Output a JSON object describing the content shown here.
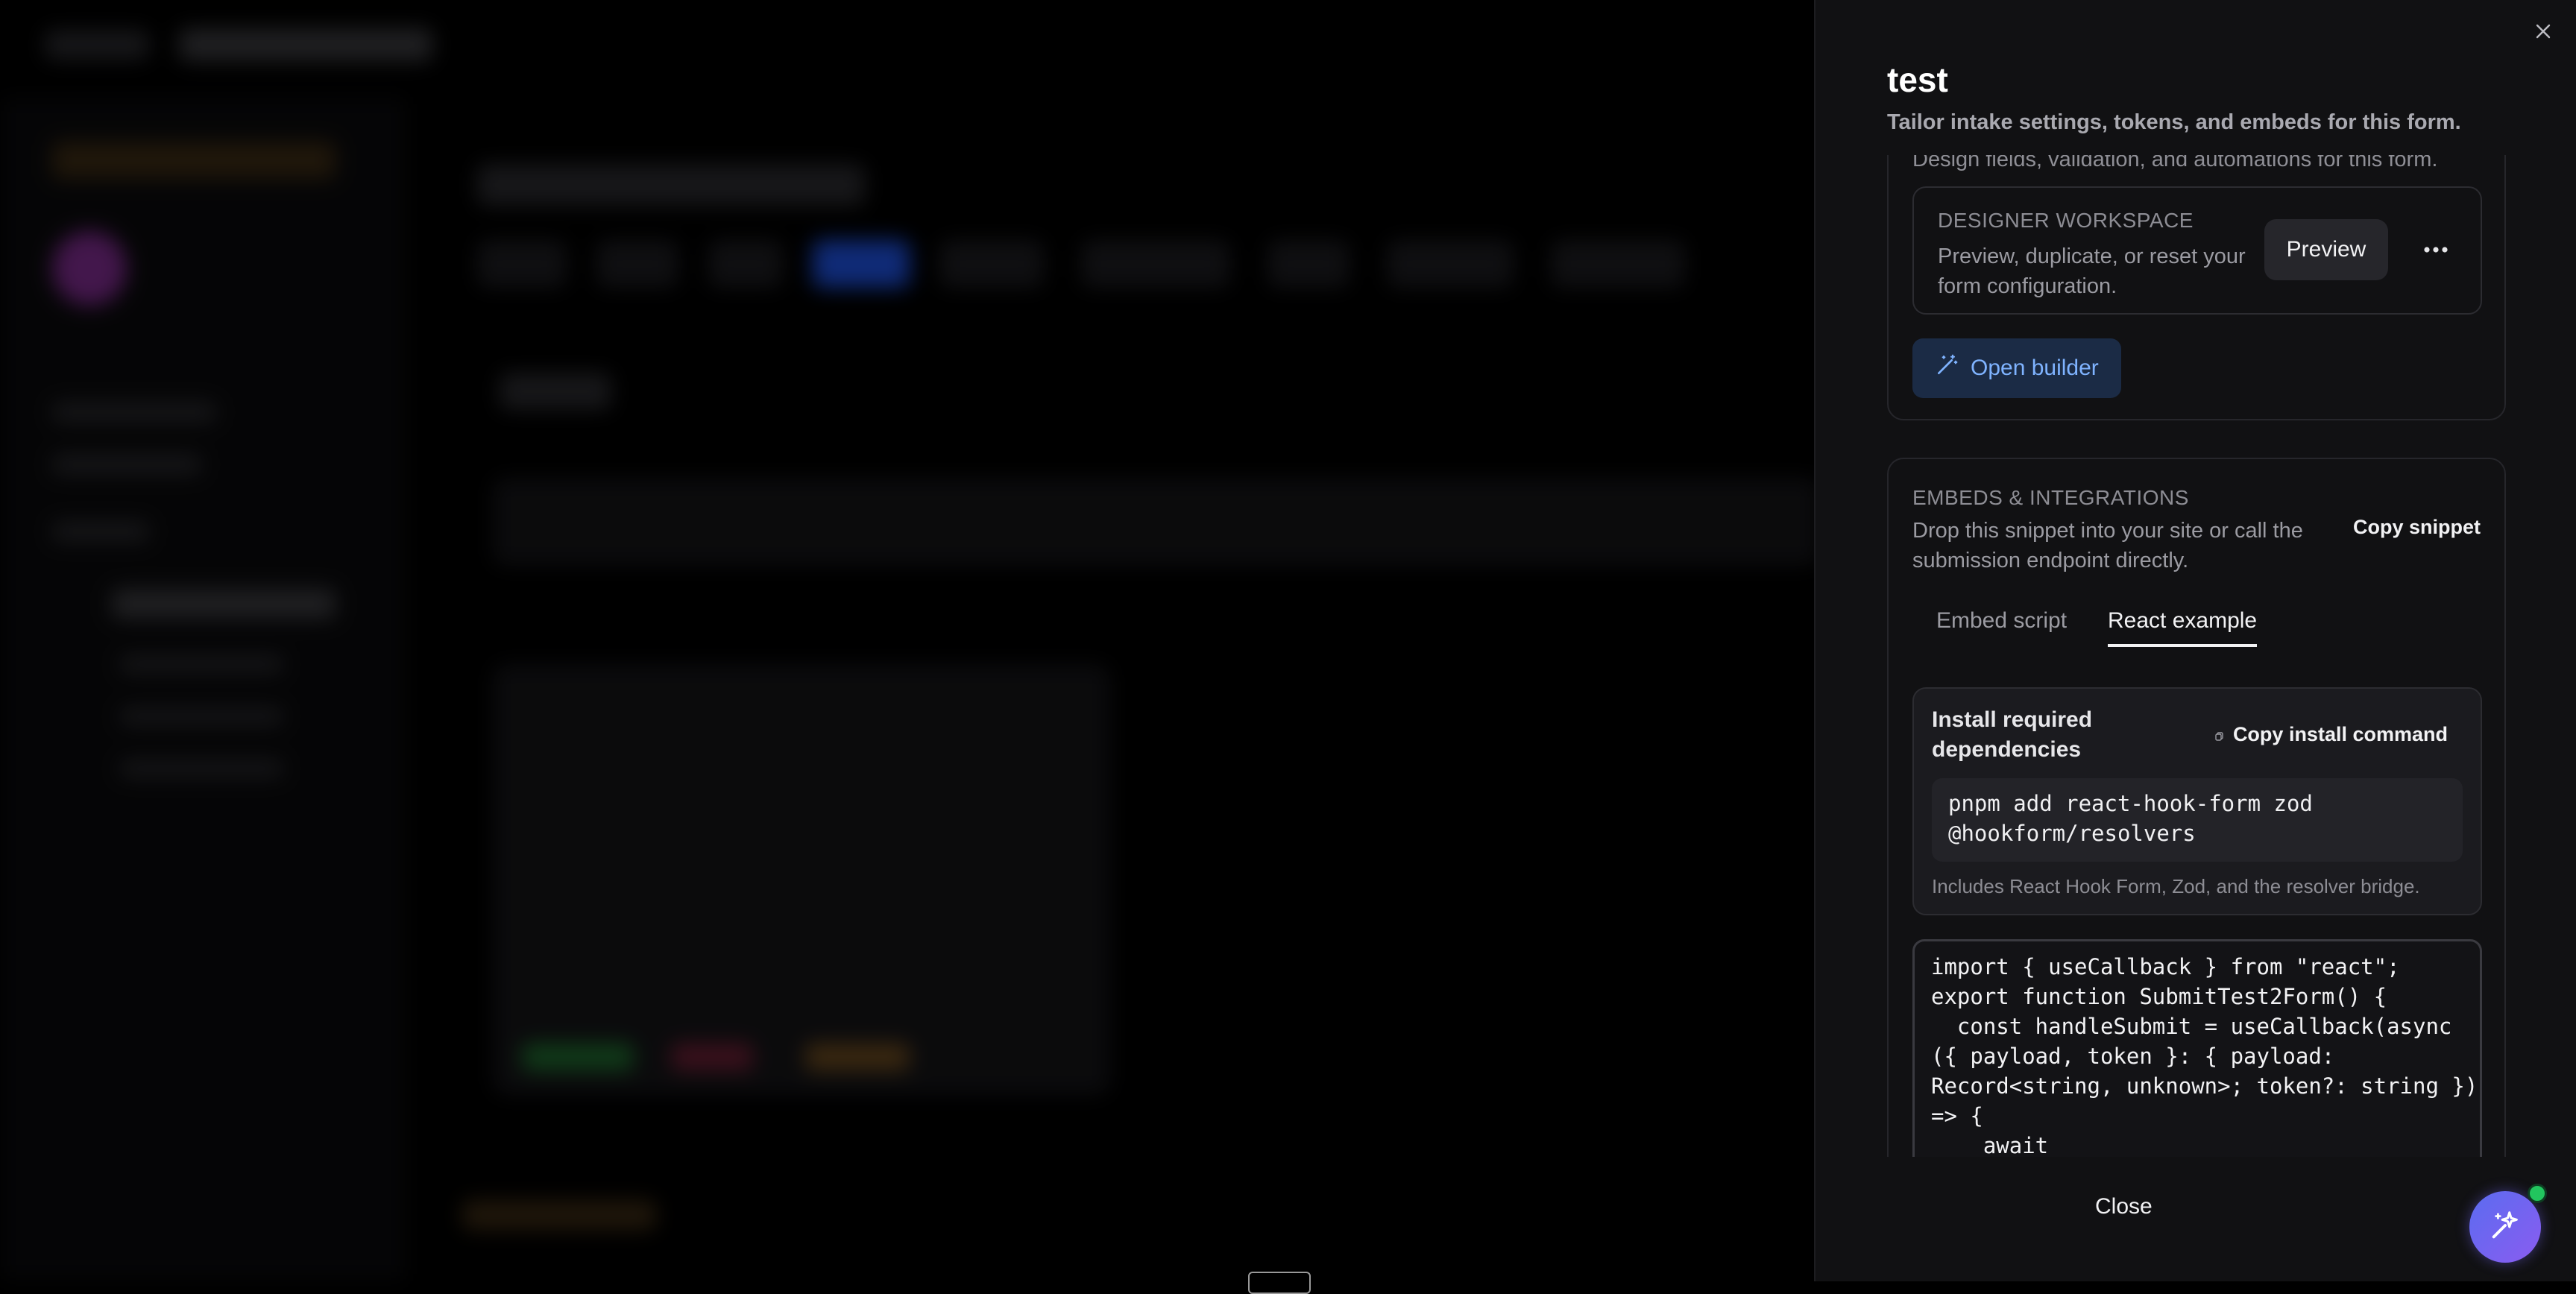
{
  "drawer": {
    "title": "test",
    "subtitle": "Tailor intake settings, tokens, and embeds for this form.",
    "designer": {
      "description": "Design fields, validation, and automations for this form.",
      "workspace_heading": "DESIGNER WORKSPACE",
      "workspace_text": "Preview, duplicate, or reset your form configuration.",
      "preview_label": "Preview",
      "open_builder_label": "Open builder"
    },
    "embeds": {
      "heading": "EMBEDS & INTEGRATIONS",
      "description": "Drop this snippet into your site or call the submission endpoint directly.",
      "copy_snippet_label": "Copy snippet",
      "tabs": [
        {
          "label": "Embed script",
          "active": false
        },
        {
          "label": "React example",
          "active": true
        }
      ],
      "install": {
        "title": "Install required dependencies",
        "copy_label": "Copy install command",
        "command": "pnpm add react-hook-form zod\n@hookform/resolvers",
        "note": "Includes React Hook Form, Zod, and the resolver bridge."
      },
      "code": "import { useCallback } from \"react\";\nexport function SubmitTest2Form() {\n  const handleSubmit = useCallback(async\n({ payload, token }: { payload:\nRecord<string, unknown>; token?: string })\n=> {\n    await"
    },
    "close_label": "Close"
  },
  "colors": {
    "accent_blue": "#7fb3ff",
    "button_bg_blue": "#1b2b45",
    "fab_gradient": [
      "#5b6cf0",
      "#8a5cf0"
    ],
    "status_green": "#22c55e"
  },
  "icons": [
    "close-icon",
    "more-horizontal-icon",
    "wand-icon",
    "copy-icon",
    "sparkles-icon"
  ]
}
